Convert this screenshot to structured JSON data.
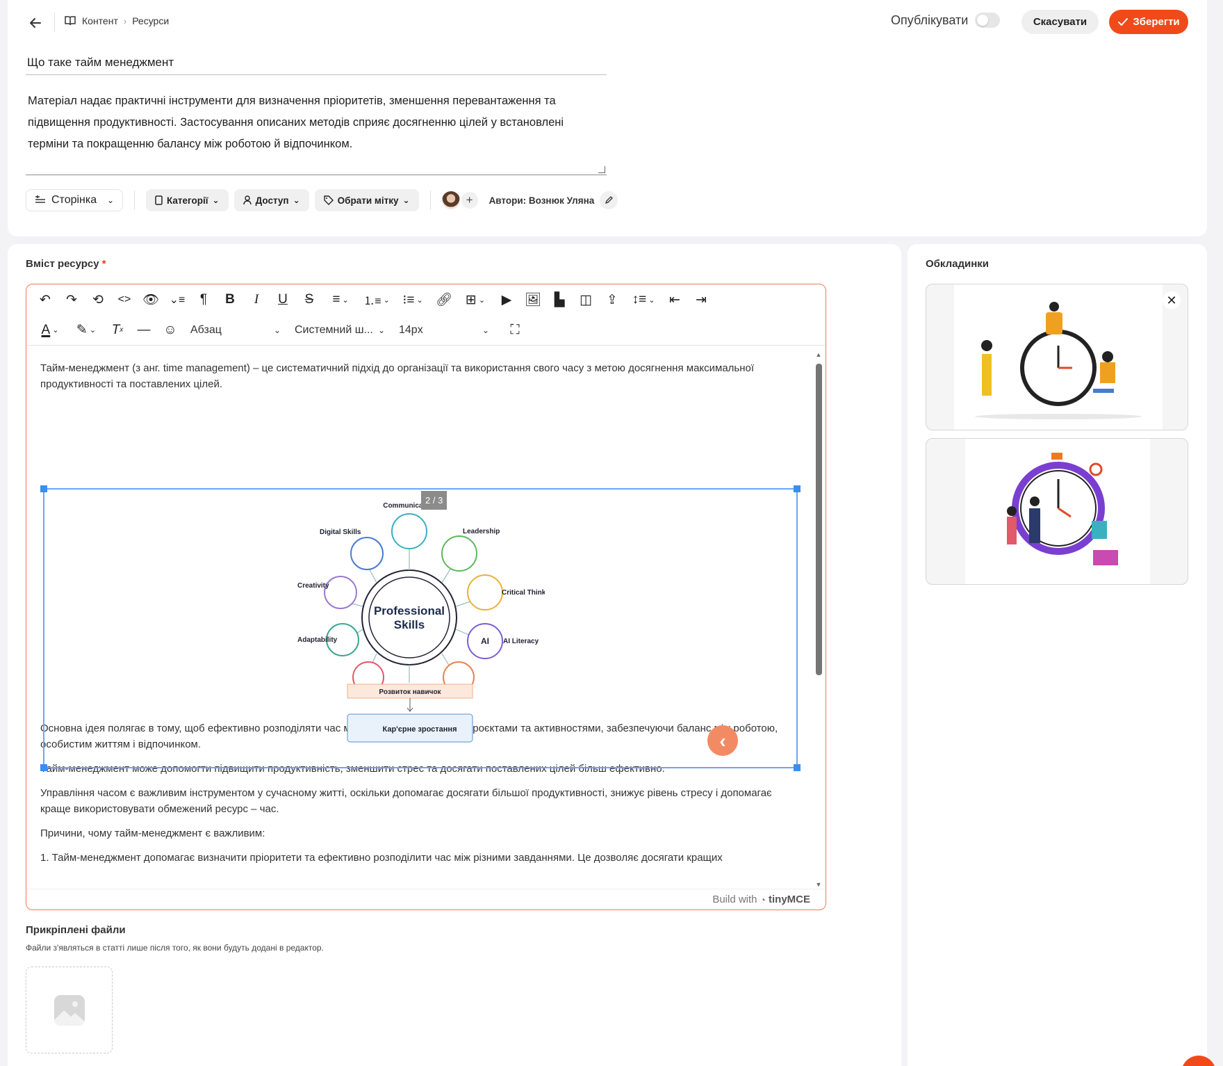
{
  "header": {
    "back_icon": "arrow-left-icon",
    "breadcrumb": [
      "Контент",
      "Ресурси"
    ],
    "publish_label": "Опублікувати",
    "publish_on": false,
    "cancel_label": "Скасувати",
    "save_label": "Зберегти",
    "accent_color": "#f04a1a"
  },
  "form": {
    "title": "Що таке тайм менеджмент",
    "description": "Матеріал надає практичні інструменти для визначення пріоритетів, зменшення перевантаження та підвищення продуктивності. Застосування описаних методів сприяє досягненню цілей у встановлені терміни та покращенню балансу між роботою й відпочинком.",
    "type_label": "Сторінка",
    "categories_label": "Категорії",
    "access_label": "Доступ",
    "tag_label": "Обрати мітку",
    "authors_label": "Автори: Вознюк Уляна"
  },
  "content_section": {
    "label": "Вміст ресурсу",
    "required_mark": "*"
  },
  "editor": {
    "block_format": "Абзац",
    "font_family": "Системний ш...",
    "font_size": "14px",
    "slide_counter": "2 / 3",
    "intro": "Тайм-менеджмент (з анг. time management) – це систематичний підхід до організації та використання свого часу з метою досягнення максимальної продуктивності та поставлених цілей.",
    "paragraphs": [
      "Основна ідея полягає в тому, щоб ефективно розподіляти час між різними завданнями, проєктами та активностями, забезпечуючи баланс між роботою, особистим життям і відпочинком.",
      "Тайм-менеджмент може допомогти підвищити продуктивність, зменшити стрес та досягати поставлених цілей більш ефективно.",
      "Управління часом є важливим інструментом у сучасному житті, оскільки допомагає досягати більшої продуктивності, знижує рівень стресу і допомагає краще використовувати обмежений ресурс – час.",
      "Причини, чому тайм-менеджмент є важливим:",
      "1. Тайм-менеджмент допомагає визначити пріоритети та ефективно розподілити час між різними завданнями. Це дозволяє досягати кращих"
    ],
    "footer_prefix": "Build with",
    "footer_brand": "tinyMCE",
    "diagram": {
      "center": "Professional Skills",
      "nodes": [
        "Communication",
        "Leadership",
        "Critical Thinking",
        "AI Literacy",
        "Adaptability",
        "Creativity",
        "Digital Skills"
      ],
      "ai_badge": "AI",
      "bottom_box_1": "Розвиток навичок",
      "bottom_box_2": "Кар'єрне зростання"
    }
  },
  "attachments": {
    "title": "Прикріплені файли",
    "hint": "Файли з'являться в статті лише після того, як вони будуть додані в редактор."
  },
  "covers": {
    "title": "Обкладинки"
  }
}
